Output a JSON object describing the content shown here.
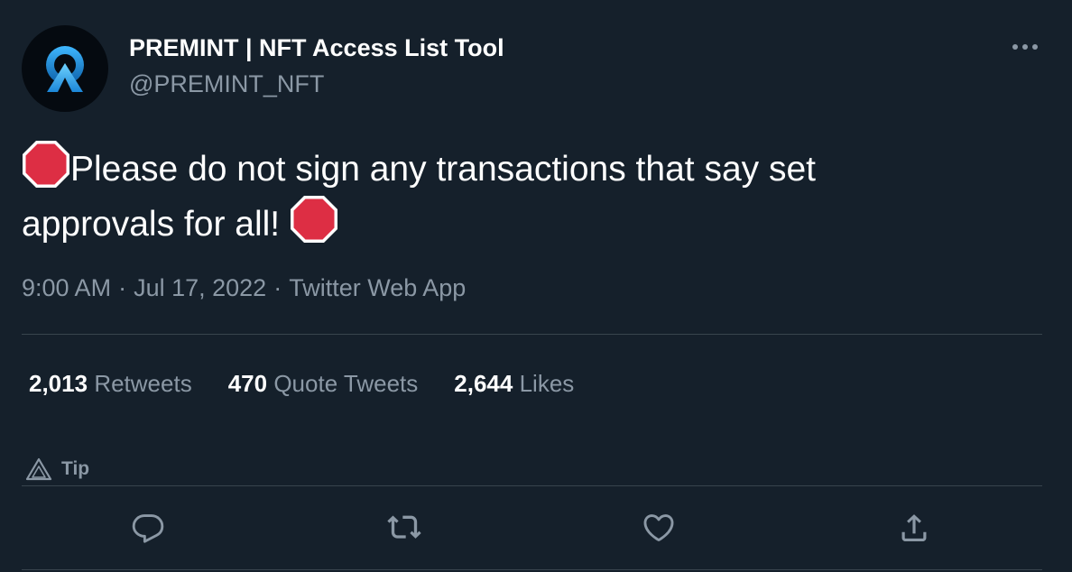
{
  "author": {
    "display_name": "PREMINT | NFT Access List Tool",
    "handle": "@PREMINT_NFT"
  },
  "tweet": {
    "text_line1": "Please do not sign any transactions that say set",
    "text_line2": "approvals for all!",
    "emoji": "stop-sign-icon"
  },
  "meta": {
    "time": "9:00 AM",
    "date": "Jul 17, 2022",
    "source": "Twitter Web App",
    "separator": "·"
  },
  "stats": {
    "retweets_count": "2,013",
    "retweets_label": "Retweets",
    "quotes_count": "470",
    "quotes_label": "Quote Tweets",
    "likes_count": "2,644",
    "likes_label": "Likes"
  },
  "tip": {
    "label": "Tip"
  },
  "actions": {
    "reply": "reply-icon",
    "retweet": "retweet-icon",
    "like": "like-icon",
    "share": "share-icon"
  },
  "colors": {
    "background": "#15202b",
    "secondary_text": "#8b98a5",
    "divider": "#38444d",
    "stop_red": "#dd2e44",
    "avatar_accent": "#1da1f2"
  }
}
